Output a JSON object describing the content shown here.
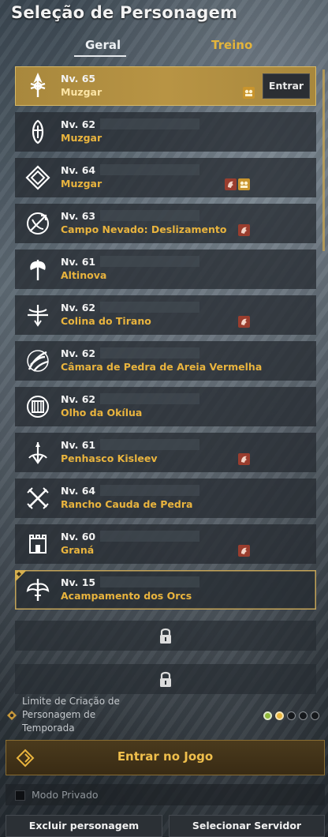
{
  "header": {
    "title": "Seleção de Personagem",
    "tabs": [
      {
        "label": "Geral",
        "active": true
      },
      {
        "label": "Treino",
        "active": false
      }
    ]
  },
  "characters": [
    {
      "level": "Nv. 65",
      "location": "Muzgar",
      "class_icon": "sword-class-icon",
      "badges": [
        "gold"
      ],
      "enter_label": "Entrar",
      "selected": true
    },
    {
      "level": "Nv. 62",
      "location": "Muzgar",
      "class_icon": "guardian-class-icon",
      "badges": []
    },
    {
      "level": "Nv. 64",
      "location": "Muzgar",
      "class_icon": "diamond-class-icon",
      "badges": [
        "red",
        "gold"
      ]
    },
    {
      "level": "Nv. 63",
      "location": "Campo Nevado: Deslizamento",
      "class_icon": "bow-class-icon",
      "badges": [
        "red"
      ]
    },
    {
      "level": "Nv. 61",
      "location": "Altinova",
      "class_icon": "axe-class-icon",
      "badges": []
    },
    {
      "level": "Nv. 62",
      "location": "Colina do Tirano",
      "class_icon": "crossbow-class-icon",
      "badges": [
        "red"
      ]
    },
    {
      "level": "Nv. 62",
      "location": "Câmara de Pedra de Areia Vermelha",
      "class_icon": "claw-class-icon",
      "badges": []
    },
    {
      "level": "Nv. 62",
      "location": "Olho da Okílua",
      "class_icon": "shield-class-icon",
      "badges": []
    },
    {
      "level": "Nv. 61",
      "location": "Penhasco Kisleev",
      "class_icon": "arrow-class-icon",
      "badges": [
        "red"
      ]
    },
    {
      "level": "Nv. 64",
      "location": "Rancho Cauda de Pedra",
      "class_icon": "crossed-swords-class-icon",
      "badges": []
    },
    {
      "level": "Nv. 60",
      "location": "Graná",
      "class_icon": "fortress-class-icon",
      "badges": [
        "red"
      ]
    },
    {
      "level": "Nv. 15",
      "location": "Acampamento dos Orcs",
      "class_icon": "winged-sword-class-icon",
      "badges": [],
      "season": true
    }
  ],
  "locked_slots": 2,
  "season": {
    "label": "Limite de Criação de Personagem de Temporada",
    "line1": "Limite de Criação de",
    "line2": "Personagem de",
    "line3": "Temporada",
    "dots": [
      "green",
      "gold",
      "empty",
      "empty",
      "empty"
    ]
  },
  "actions": {
    "enter_game": "Entrar no Jogo",
    "private_mode": "Modo Privado",
    "delete_character": "Excluir personagem",
    "select_server": "Selecionar Servidor"
  },
  "colors": {
    "accent_gold": "#e9b43e",
    "badge_red": "#9a3d2e",
    "badge_gold": "#c9952d",
    "dot_green": "#8fb83a"
  }
}
